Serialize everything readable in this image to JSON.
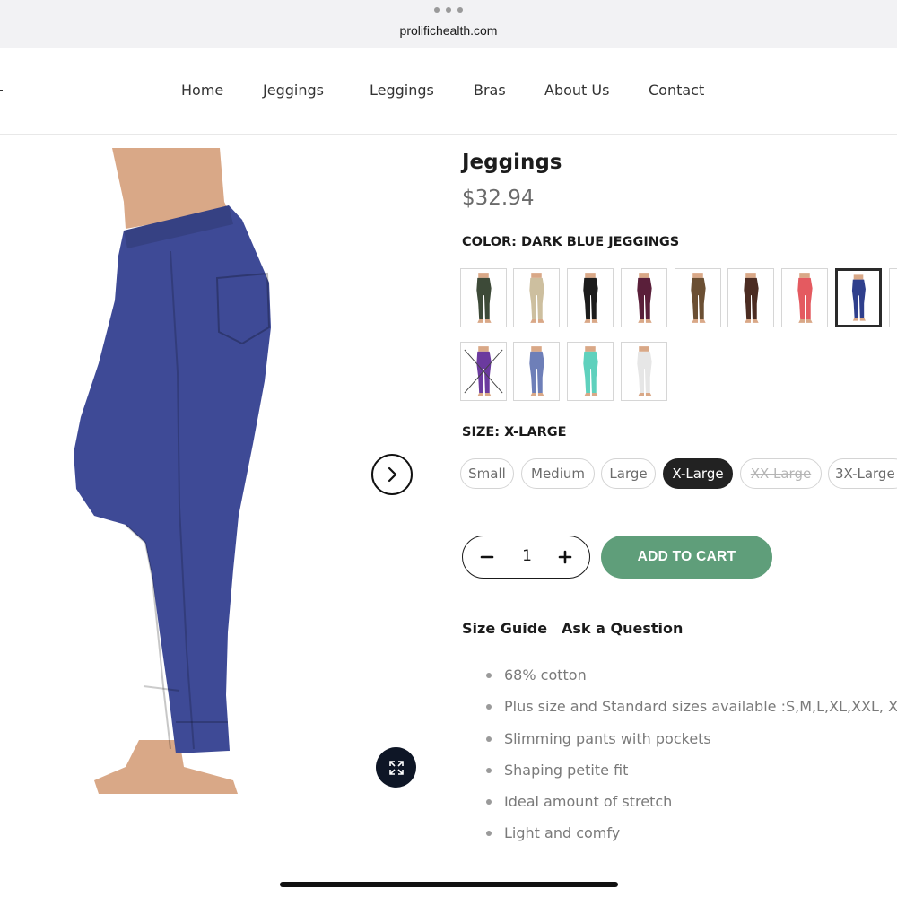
{
  "browser": {
    "url": "prolifichealth.com"
  },
  "nav": {
    "items": [
      {
        "label": "Home"
      },
      {
        "label": "Jeggings"
      },
      {
        "label": "Leggings"
      },
      {
        "label": "Bras"
      },
      {
        "label": "About Us"
      },
      {
        "label": "Contact"
      }
    ]
  },
  "product": {
    "title": "Jeggings",
    "price": "$32.94",
    "color_label": "COLOR: DARK BLUE JEGGINGS",
    "swatch_colors": [
      "#3d4a38",
      "#cdbf9f",
      "#1c1c1c",
      "#5a1f3a",
      "#6b4f33",
      "#4b2c22",
      "#e45a60",
      "#2f3f8c",
      "#1e2230",
      "#6b3a9e",
      "#6e7fb8",
      "#5fd1bd",
      "#e6e6e6"
    ],
    "selected_color_index": 7,
    "unavailable_color_index": 9,
    "image_color": "#3e4a96",
    "size_label": "SIZE: X-LARGE",
    "sizes": [
      {
        "label": "Small",
        "state": "available"
      },
      {
        "label": "Medium",
        "state": "available"
      },
      {
        "label": "Large",
        "state": "available"
      },
      {
        "label": "X-Large",
        "state": "selected"
      },
      {
        "label": "XX-Large",
        "state": "sold-out"
      },
      {
        "label": "3X-Large",
        "state": "available"
      }
    ],
    "quantity": "1",
    "add_to_cart": "ADD TO CART",
    "add_to_cart_color": "#5f9e7a",
    "links": {
      "size_guide": "Size Guide",
      "ask_question": "Ask a Question"
    },
    "features": [
      "68% cotton",
      "Plus size and Standard sizes available :S,M,L,XL,XXL, XX",
      "Slimming pants with pockets",
      "Shaping petite fit",
      "Ideal amount of stretch",
      "Light and comfy"
    ]
  }
}
